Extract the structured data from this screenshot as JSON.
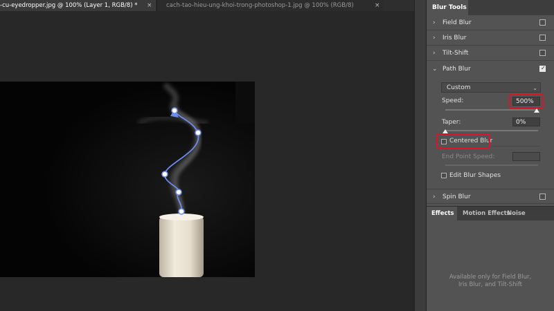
{
  "tabs": [
    {
      "title": "-cu-eyedropper.jpg @ 100% (Layer 1, RGB/8) *",
      "close": "×"
    },
    {
      "title": "cach-tao-hieu-ung-khoi-trong-photoshop-1.jpg @ 100% (RGB/8)",
      "close": "×"
    }
  ],
  "panel": {
    "title": "Blur Tools",
    "sections": [
      {
        "label": "Field Blur",
        "checked": false
      },
      {
        "label": "Iris Blur",
        "checked": false
      },
      {
        "label": "Tilt-Shift",
        "checked": false
      },
      {
        "label": "Path Blur",
        "checked": true
      }
    ],
    "path_blur": {
      "preset": "Custom",
      "speed_label": "Speed:",
      "speed_value": "500%",
      "taper_label": "Taper:",
      "taper_value": "0%",
      "centered_blur_label": "Centered Blur",
      "end_point_speed_label": "End Point Speed:",
      "edit_blur_shapes_label": "Edit Blur Shapes"
    },
    "spin_blur": {
      "label": "Spin Blur",
      "checked": false
    }
  },
  "bottom_tabs": [
    "Effects",
    "Motion Effects",
    "Noise"
  ],
  "info_text": "Available only for Field Blur,\nIris Blur, and Tilt-Shift",
  "icons": {
    "expand": "chevron-right-icon",
    "collapse": "chevron-down-icon",
    "dropdown": "chevron-down-icon"
  },
  "colors": {
    "highlight": "#d8152a",
    "path": "#6e8cf0",
    "panel": "#535353"
  }
}
